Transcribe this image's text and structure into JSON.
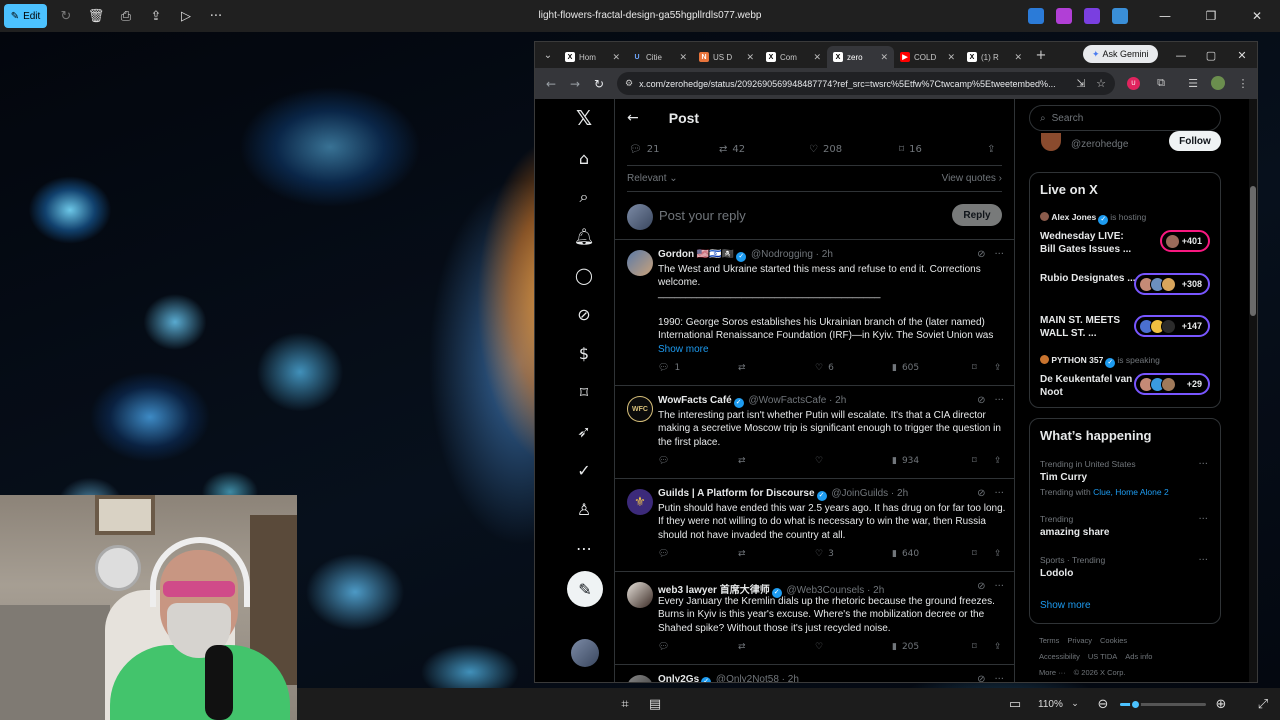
{
  "photos_app": {
    "edit_label": "Edit",
    "file_name": "light-flowers-fractal-design-ga55hgpllrdls077.webp",
    "zoom": "110%",
    "zoom_level": 0.18
  },
  "browser": {
    "tabs": [
      {
        "label": "Hom",
        "icon": "x-logo-icon"
      },
      {
        "label": "Citie",
        "icon": "upi-icon"
      },
      {
        "label": "US D",
        "icon": "news-icon"
      },
      {
        "label": "Com",
        "icon": "x-logo-icon"
      },
      {
        "label": "zero",
        "icon": "x-logo-icon",
        "active": true
      },
      {
        "label": "COLD",
        "icon": "youtube-icon"
      },
      {
        "label": "(1) R",
        "icon": "x-logo-icon"
      }
    ],
    "gemini_label": "Ask Gemini",
    "url": "x.com/zerohedge/status/2092690569948487774?ref_src=twsrc%5Etfw%7Ctwcamp%5Etweetembed%..."
  },
  "x": {
    "header_title": "Post",
    "stats": {
      "replies": "21",
      "reposts": "42",
      "likes": "208",
      "bookmarks": "16"
    },
    "sort_label": "Relevant",
    "view_quotes": "View quotes",
    "reply_placeholder": "Post your reply",
    "reply_button": "Reply",
    "tweets": [
      {
        "name": "Gordon 🇺🇸🇮🇱🏴‍☠️",
        "handle": "@Nodrogging · 2h",
        "text": "The West and Ukraine started this mess and refuse to end it.  Corrections welcome.",
        "divider": "________________________________________",
        "text2": "1990: George Soros establishes his Ukrainian branch of the (later named) International Renaissance Foundation (IRF)—in Kyiv. The Soviet Union was",
        "show_more": "Show more",
        "replies": "1",
        "reposts": "",
        "likes": "6",
        "views": "605"
      },
      {
        "name": "WowFacts Café",
        "handle": "@WowFactsCafe · 2h",
        "avatar_text": "WFC",
        "text": "The interesting part isn't whether Putin will escalate. It's that a CIA director making a secretive Moscow trip is significant enough to trigger the question in the first place.",
        "replies": "",
        "reposts": "",
        "likes": "",
        "views": "934"
      },
      {
        "name": "Guilds | A Platform for Discourse",
        "handle": "@JoinGuilds · 2h",
        "text": "Putin should have ended this war 2.5 years ago. It has drug on for far too long. If they were not willing to do what is necessary to win the war, then Russia should not have invaded the country at all.",
        "replies": "",
        "reposts": "",
        "likes": "3",
        "views": "640"
      },
      {
        "name": "web3 lawyer 首席大律师",
        "handle": "@Web3Counsels · 2h",
        "text": "Every January the Kremlin dials up the rhetoric because the ground freezes. Burns in Kyiv is this year's excuse. Where's the mobilization decree or the Shahed spike? Without those it's just recycled noise.",
        "replies": "",
        "reposts": "",
        "likes": "",
        "views": "205"
      },
      {
        "name": "Only2Gs",
        "handle": "@Only2Not58 · 2h",
        "text": "",
        "replies": "",
        "reposts": "",
        "likes": "",
        "views": ""
      }
    ],
    "sidebar": {
      "search_placeholder": "Search",
      "profile_handle": "@zerohedge",
      "follow_label": "Follow",
      "live_title": "Live on X",
      "live": [
        {
          "host": "Alex Jones",
          "status": "is hosting",
          "title": "Wednesday LIVE: Bill Gates Issues ...",
          "count": "+401"
        },
        {
          "host": "",
          "status": "",
          "title": "Rubio Designates ...",
          "count": "+308"
        },
        {
          "host": "",
          "status": "",
          "title": "MAIN ST. MEETS WALL ST. ...",
          "count": "+147"
        },
        {
          "host": "PYTHON 357",
          "status": "is speaking",
          "title": "De Keukentafel van Noot",
          "count": "+29"
        }
      ],
      "happening_title": "What’s happening",
      "trends": [
        {
          "context": "Trending in United States",
          "name": "Tim Curry",
          "with_prefix": "Trending with ",
          "with_links": "Clue, Home Alone 2"
        },
        {
          "context": "Trending",
          "name": "amazing share",
          "with_prefix": "",
          "with_links": ""
        },
        {
          "context": "Sports · Trending",
          "name": "Lodolo",
          "with_prefix": "",
          "with_links": ""
        }
      ],
      "show_more": "Show more",
      "footer": [
        "Terms",
        "Privacy",
        "Cookies",
        "Accessibility",
        "US TIDA",
        "Ads info",
        "More ···",
        "© 2026 X Corp."
      ]
    }
  },
  "colors": {
    "accent": "#1d9bf0",
    "photos_accent": "#4cc2ff",
    "live_ring": "#7856ff",
    "live_red": "#f91880"
  }
}
